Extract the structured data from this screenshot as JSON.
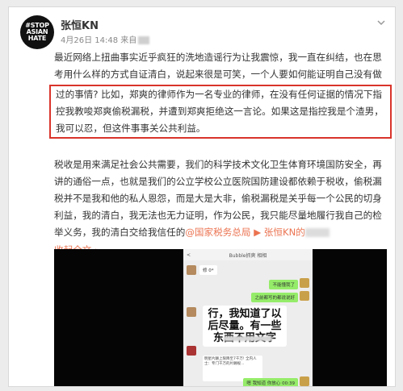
{
  "post": {
    "avatar_lines": [
      "#STOP",
      "ASIAN",
      "HATE"
    ],
    "username": "张恒KN",
    "meta": "4月26日 14:48 来自",
    "paragraph1_before": "最近网络上扭曲事实近乎疯狂的洗地造谣行为让我震惊，我一直在纠结，也在思考用什么样的方式自证清白，说起来很是可笑，一个人要如何能证明自己没有做",
    "paragraph1_highlight": "过的事情? 比如，郑爽的律师作为一名专业的律师，在没有任何证据的情况下指控我教唆郑爽偷税漏税，并遭到郑爽拒绝这一言论。如果这是指控我是个渣男，我可以忍，但这件事事关公共利益。",
    "paragraph2": "税收是用来满足社会公共需要，我们的科学技术文化卫生体育环境国防安全，再讲的通俗一点，也就是我们的公立学校公立医院国防建设都依赖于税收，偷税漏税并不是我和他的私人恩怨，而是大是大非，偷税漏税是关乎每一个公民的切身利益，我的清白，我无法也无力证明，作为公民，我只能尽量地履行我自己的检举义务，我的清白交给我信任的",
    "mention1": "@国家税务总局",
    "mention2": "张恒KN的",
    "collapse": "收起全文",
    "collapse_arrow": "▲"
  },
  "video": {
    "chat_title": "Bubble抓爽  相相",
    "back": "<",
    "sender_label": "修 0*",
    "bubble_1": "不能懂我了",
    "bubble_2": "之前都写的都说说好",
    "big_message": "行，我知道了以后尽量。有一些东西不用文字",
    "card_text": "明星片酬上限降至7千万! 全内人士：专门千万的片酬规…",
    "bubble_3": "嗯 我知道 你放心 00:39"
  },
  "colors": {
    "highlight_border": "#d9342b",
    "link": "#eb7350",
    "wechat_green": "#95ec69"
  }
}
